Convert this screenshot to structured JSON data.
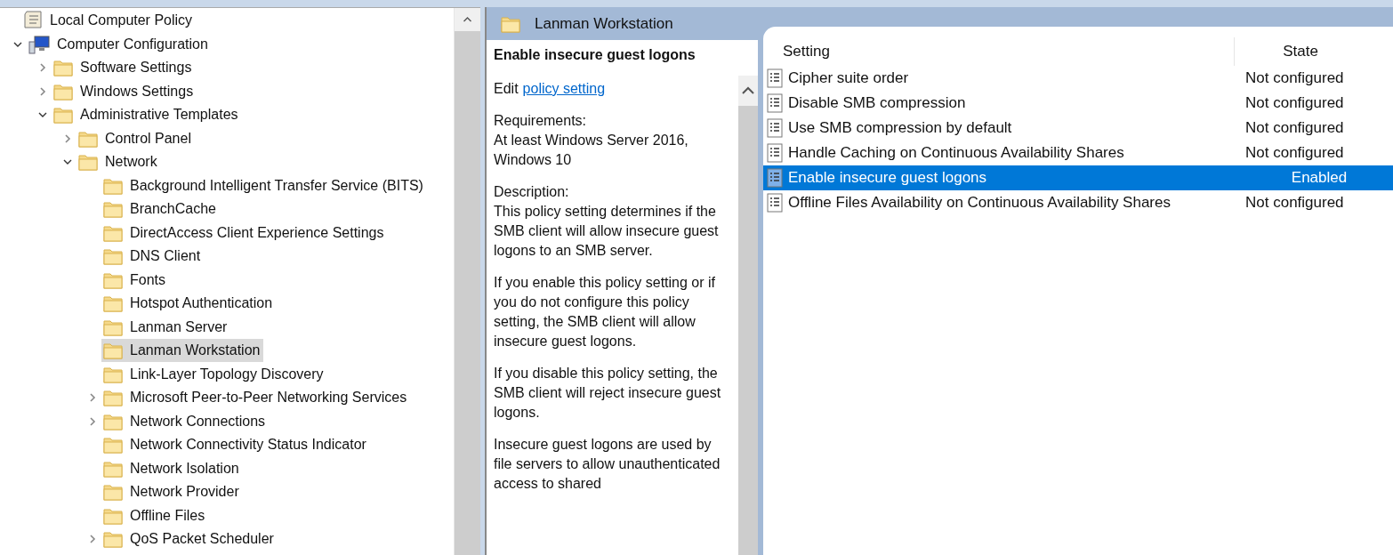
{
  "tree": [
    {
      "label": "Local Computer Policy",
      "kind": "policy",
      "selected": false,
      "children": [
        {
          "label": "Computer Configuration",
          "kind": "computer",
          "expandable": true,
          "expanded": true,
          "selected": false,
          "children": [
            {
              "label": "Software Settings",
              "kind": "folder",
              "expandable": true,
              "expanded": false,
              "selected": false
            },
            {
              "label": "Windows Settings",
              "kind": "folder",
              "expandable": true,
              "expanded": false,
              "selected": false
            },
            {
              "label": "Administrative Templates",
              "kind": "folder",
              "expandable": true,
              "expanded": true,
              "selected": false,
              "children": [
                {
                  "label": "Control Panel",
                  "kind": "folder",
                  "expandable": true,
                  "expanded": false,
                  "selected": false
                },
                {
                  "label": "Network",
                  "kind": "folder",
                  "expandable": true,
                  "expanded": true,
                  "selected": false,
                  "children": [
                    {
                      "label": "Background Intelligent Transfer Service (BITS)",
                      "kind": "folder",
                      "selected": false
                    },
                    {
                      "label": "BranchCache",
                      "kind": "folder",
                      "selected": false
                    },
                    {
                      "label": "DirectAccess Client Experience Settings",
                      "kind": "folder",
                      "selected": false
                    },
                    {
                      "label": "DNS Client",
                      "kind": "folder",
                      "selected": false
                    },
                    {
                      "label": "Fonts",
                      "kind": "folder",
                      "selected": false
                    },
                    {
                      "label": "Hotspot Authentication",
                      "kind": "folder",
                      "selected": false
                    },
                    {
                      "label": "Lanman Server",
                      "kind": "folder",
                      "selected": false
                    },
                    {
                      "label": "Lanman Workstation",
                      "kind": "folder",
                      "selected": true
                    },
                    {
                      "label": "Link-Layer Topology Discovery",
                      "kind": "folder",
                      "selected": false
                    },
                    {
                      "label": "Microsoft Peer-to-Peer Networking Services",
                      "kind": "folder",
                      "expandable": true,
                      "expanded": false,
                      "selected": false
                    },
                    {
                      "label": "Network Connections",
                      "kind": "folder",
                      "expandable": true,
                      "expanded": false,
                      "selected": false
                    },
                    {
                      "label": "Network Connectivity Status Indicator",
                      "kind": "folder",
                      "selected": false
                    },
                    {
                      "label": "Network Isolation",
                      "kind": "folder",
                      "selected": false
                    },
                    {
                      "label": "Network Provider",
                      "kind": "folder",
                      "selected": false
                    },
                    {
                      "label": "Offline Files",
                      "kind": "folder",
                      "selected": false
                    },
                    {
                      "label": "QoS Packet Scheduler",
                      "kind": "folder",
                      "expandable": true,
                      "expanded": false,
                      "selected": false
                    }
                  ]
                }
              ]
            }
          ]
        }
      ]
    }
  ],
  "header": {
    "title": "Lanman Workstation"
  },
  "description": {
    "title": "Enable insecure guest logons",
    "edit_prefix": "Edit",
    "edit_link": "policy setting",
    "sections": [
      {
        "label": "Requirements:",
        "text": "At least Windows Server 2016, Windows 10"
      },
      {
        "label": "Description:",
        "text": "This policy setting determines if the SMB client will allow insecure guest logons to an SMB server."
      },
      {
        "text": "If you enable this policy setting or if you do not configure this policy setting, the SMB client will allow insecure guest logons."
      },
      {
        "text": "If you disable this policy setting, the SMB client will reject insecure guest logons."
      },
      {
        "text": "Insecure guest logons are used by file servers to allow unauthenticated access to shared"
      }
    ]
  },
  "table": {
    "columns": [
      "Setting",
      "State"
    ],
    "rows": [
      {
        "setting": "Cipher suite order",
        "state": "Not configured",
        "selected": false
      },
      {
        "setting": "Disable SMB compression",
        "state": "Not configured",
        "selected": false
      },
      {
        "setting": "Use SMB compression by default",
        "state": "Not configured",
        "selected": false
      },
      {
        "setting": "Handle Caching on Continuous Availability Shares",
        "state": "Not configured",
        "selected": false
      },
      {
        "setting": "Enable insecure guest logons",
        "state": "Enabled",
        "selected": true
      },
      {
        "setting": "Offline Files Availability on Continuous Availability Shares",
        "state": "Not configured",
        "selected": false
      }
    ]
  }
}
